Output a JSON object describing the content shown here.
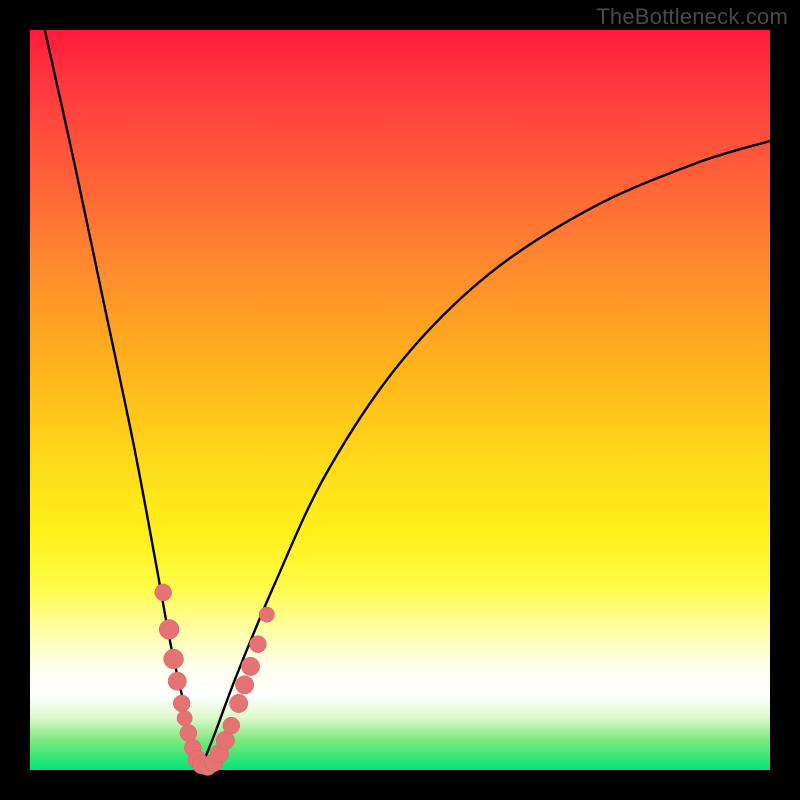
{
  "watermark": "TheBottleneck.com",
  "colors": {
    "frame": "#000000",
    "curve_stroke": "#000000",
    "marker_fill": "#e57373",
    "marker_stroke": "#d36565",
    "gradient_top": "#ff1a3a",
    "gradient_bottom": "#00e676"
  },
  "chart_data": {
    "type": "line",
    "title": "",
    "xlabel": "",
    "ylabel": "",
    "xlim": [
      0,
      100
    ],
    "ylim": [
      0,
      100
    ],
    "grid": false,
    "legend": false,
    "note": "Axes have no tick labels; values are normalized 0–100. y represents bottleneck mismatch (0 = ideal green, 100 = worst red). Curve forms a V with minimum near x≈23.",
    "series": [
      {
        "name": "left-arm",
        "x": [
          2,
          6,
          10,
          14,
          17,
          19,
          21,
          22,
          23
        ],
        "values": [
          100,
          82,
          63,
          44,
          28,
          17,
          8,
          3,
          0
        ]
      },
      {
        "name": "right-arm",
        "x": [
          23,
          25,
          28,
          33,
          40,
          50,
          62,
          76,
          90,
          100
        ],
        "values": [
          0,
          5,
          13,
          25,
          40,
          55,
          67,
          76,
          82,
          85
        ]
      }
    ],
    "markers": [
      {
        "x": 18.0,
        "y": 24,
        "r": 1.2
      },
      {
        "x": 18.8,
        "y": 19,
        "r": 1.6
      },
      {
        "x": 19.4,
        "y": 15,
        "r": 1.6
      },
      {
        "x": 19.9,
        "y": 12,
        "r": 1.4
      },
      {
        "x": 20.5,
        "y": 9,
        "r": 1.2
      },
      {
        "x": 20.9,
        "y": 7,
        "r": 1.0
      },
      {
        "x": 21.4,
        "y": 5,
        "r": 1.2
      },
      {
        "x": 22.0,
        "y": 3,
        "r": 1.2
      },
      {
        "x": 22.6,
        "y": 1.4,
        "r": 1.4
      },
      {
        "x": 23.2,
        "y": 0.7,
        "r": 1.4
      },
      {
        "x": 24.0,
        "y": 0.5,
        "r": 1.4
      },
      {
        "x": 24.8,
        "y": 1.0,
        "r": 1.4
      },
      {
        "x": 25.6,
        "y": 2.2,
        "r": 1.4
      },
      {
        "x": 26.4,
        "y": 4.0,
        "r": 1.4
      },
      {
        "x": 27.2,
        "y": 6.0,
        "r": 1.2
      },
      {
        "x": 28.2,
        "y": 9.0,
        "r": 1.4
      },
      {
        "x": 29.0,
        "y": 11.5,
        "r": 1.4
      },
      {
        "x": 29.8,
        "y": 14.0,
        "r": 1.4
      },
      {
        "x": 30.8,
        "y": 17.0,
        "r": 1.2
      },
      {
        "x": 32.0,
        "y": 21.0,
        "r": 1.0
      }
    ]
  }
}
